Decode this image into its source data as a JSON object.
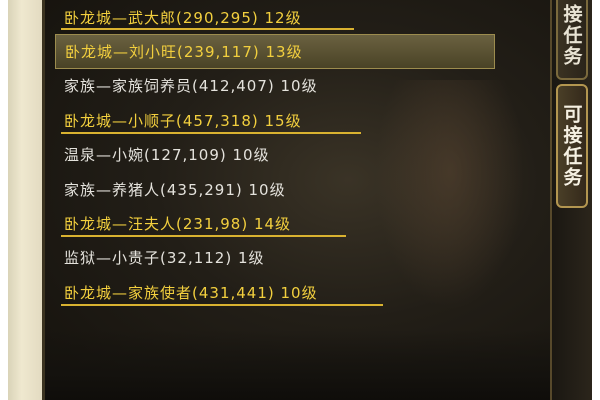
{
  "quest_list": [
    {
      "text": "卧龙城—武大郎(290,295)  12级",
      "style": "yellow",
      "selected": false
    },
    {
      "text": "卧龙城—刘小旺(239,117)  13级",
      "style": "yellow",
      "selected": true
    },
    {
      "text": "家族—家族饲养员(412,407)  10级",
      "style": "white",
      "selected": false
    },
    {
      "text": "卧龙城—小顺子(457,318)  15级",
      "style": "yellow",
      "selected": false
    },
    {
      "text": "温泉—小婉(127,109)  10级",
      "style": "white",
      "selected": false
    },
    {
      "text": "家族—养猪人(435,291)  10级",
      "style": "white",
      "selected": false
    },
    {
      "text": "卧龙城—汪夫人(231,98)  14级",
      "style": "yellow",
      "selected": false
    },
    {
      "text": "监狱—小贵子(32,112)  1级",
      "style": "white",
      "selected": false
    },
    {
      "text": "卧龙城—家族使者(431,441)  10级",
      "style": "yellow",
      "selected": false
    }
  ],
  "tabs": {
    "accept_quest_partial": "接任务",
    "available_quest": "可接任务"
  },
  "colors": {
    "highlight_text": "#f2cf3e",
    "normal_text": "#e4e2dc",
    "panel_bg": "#1b1812",
    "tab_border": "#b39650"
  }
}
